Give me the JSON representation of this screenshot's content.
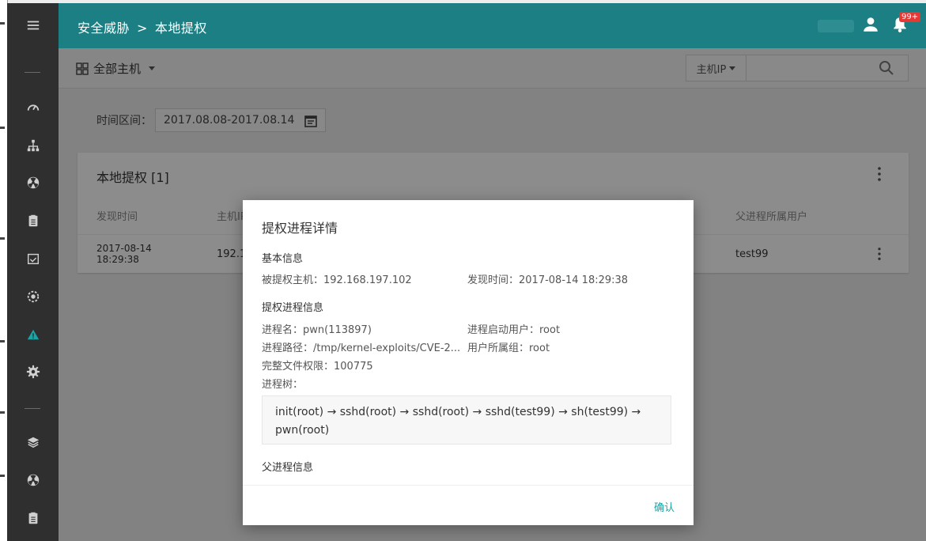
{
  "breadcrumb": {
    "section": "安全威胁",
    "separator": ">",
    "page": "本地提权"
  },
  "notifications": {
    "badge": "99+"
  },
  "host_filter": {
    "label": "全部主机"
  },
  "search": {
    "type_label": "主机IP",
    "placeholder": ""
  },
  "time_range": {
    "label": "时间区间：",
    "value": "2017.08.08-2017.08.14"
  },
  "card": {
    "title": "本地提权 [1]",
    "columns": [
      "发现时间",
      "主机IP",
      "父进程所属用户"
    ],
    "rows": [
      {
        "time_line1": "2017-08-14",
        "time_line2": "18:29:38",
        "host": "192.1",
        "parent_user": "test99"
      }
    ]
  },
  "modal": {
    "title": "提权进程详情",
    "basic_section": "基本信息",
    "host_label": "被提权主机：192.168.197.102",
    "found_time": "发现时间：2017-08-14 18:29:38",
    "proc_section": "提权进程信息",
    "proc_name": "进程名：pwn(113897)",
    "proc_user": "进程启动用户：root",
    "proc_path": "进程路径：/tmp/kernel-exploits/CVE-2...",
    "proc_group": "用户所属组：root",
    "proc_perm": "完整文件权限：100775",
    "proc_tree_label": "进程树：",
    "proc_tree": "init(root) → sshd(root) → sshd(root) → sshd(test99) → sh(test99) → pwn(root)",
    "parent_section": "父进程信息",
    "confirm": "确认"
  },
  "colors": {
    "accent": "#1b7f83",
    "teal": "#17a5a5",
    "sidebar": "#2f2f2f",
    "badge": "#e53935"
  },
  "icons": [
    "menu-icon",
    "dashboard-icon",
    "network-icon",
    "radiation-icon",
    "clipboard-icon",
    "calendar-check-icon",
    "settings-gear-icon",
    "warning-icon",
    "gear-icon",
    "layers-icon",
    "radiation-icon-2",
    "clipboard-icon-2"
  ]
}
